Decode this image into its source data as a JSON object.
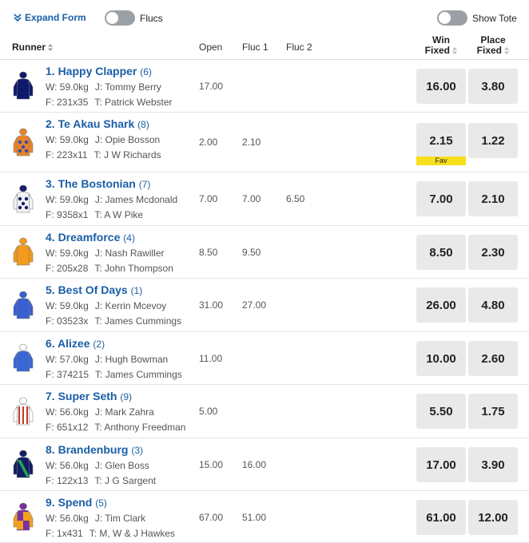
{
  "controls": {
    "expand_form": "Expand Form",
    "flucs_label": "Flucs",
    "show_tote_label": "Show Tote"
  },
  "header": {
    "runner": "Runner",
    "open": "Open",
    "fluc1": "Fluc 1",
    "fluc2": "Fluc 2",
    "win_line1": "Win",
    "win_line2": "Fixed",
    "place_line1": "Place",
    "place_line2": "Fixed"
  },
  "runners": [
    {
      "name": "1. Happy Clapper",
      "barrier": "(6)",
      "weight": "W: 59.0kg",
      "jockey": "J: Tommy Berry",
      "form": "F: 231x35",
      "trainer": "T: Patrick Webster",
      "open": "17.00",
      "fluc1": "",
      "fluc2": "",
      "win": "16.00",
      "place": "3.80",
      "fav": ""
    },
    {
      "name": "2. Te Akau Shark",
      "barrier": "(8)",
      "weight": "W: 59.0kg",
      "jockey": "J: Opie Bosson",
      "form": "F: 223x11",
      "trainer": "T: J W Richards",
      "open": "2.00",
      "fluc1": "2.10",
      "fluc2": "",
      "win": "2.15",
      "place": "1.22",
      "fav": "Fav"
    },
    {
      "name": "3. The Bostonian",
      "barrier": "(7)",
      "weight": "W: 59.0kg",
      "jockey": "J: James Mcdonald",
      "form": "F: 9358x1",
      "trainer": "T: A W Pike",
      "open": "7.00",
      "fluc1": "7.00",
      "fluc2": "6.50",
      "win": "7.00",
      "place": "2.10",
      "fav": ""
    },
    {
      "name": "4. Dreamforce",
      "barrier": "(4)",
      "weight": "W: 59.0kg",
      "jockey": "J: Nash Rawiller",
      "form": "F: 205x28",
      "trainer": "T: John Thompson",
      "open": "8.50",
      "fluc1": "9.50",
      "fluc2": "",
      "win": "8.50",
      "place": "2.30",
      "fav": ""
    },
    {
      "name": "5. Best Of Days",
      "barrier": "(1)",
      "weight": "W: 59.0kg",
      "jockey": "J: Kerrin Mcevoy",
      "form": "F: 03523x",
      "trainer": "T: James Cummings",
      "open": "31.00",
      "fluc1": "27.00",
      "fluc2": "",
      "win": "26.00",
      "place": "4.80",
      "fav": ""
    },
    {
      "name": "6. Alizee",
      "barrier": "(2)",
      "weight": "W: 57.0kg",
      "jockey": "J: Hugh Bowman",
      "form": "F: 374215",
      "trainer": "T: James Cummings",
      "open": "11.00",
      "fluc1": "",
      "fluc2": "",
      "win": "10.00",
      "place": "2.60",
      "fav": ""
    },
    {
      "name": "7. Super Seth",
      "barrier": "(9)",
      "weight": "W: 56.0kg",
      "jockey": "J: Mark Zahra",
      "form": "F: 651x12",
      "trainer": "T: Anthony Freedman",
      "open": "5.00",
      "fluc1": "",
      "fluc2": "",
      "win": "5.50",
      "place": "1.75",
      "fav": ""
    },
    {
      "name": "8. Brandenburg",
      "barrier": "(3)",
      "weight": "W: 56.0kg",
      "jockey": "J: Glen Boss",
      "form": "F: 122x13",
      "trainer": "T: J G Sargent",
      "open": "15.00",
      "fluc1": "16.00",
      "fluc2": "",
      "win": "17.00",
      "place": "3.90",
      "fav": ""
    },
    {
      "name": "9. Spend",
      "barrier": "(5)",
      "weight": "W: 56.0kg",
      "jockey": "J: Tim Clark",
      "form": "F: 1x431",
      "trainer": "T: M, W & J Hawkes",
      "open": "67.00",
      "fluc1": "51.00",
      "fluc2": "",
      "win": "61.00",
      "place": "12.00",
      "fav": ""
    }
  ],
  "silks": [
    {
      "icon": "silk-navy-icon",
      "body": "#0d1a6b",
      "sleeves": "#0d1a6b",
      "cap": "#0d1a6b"
    },
    {
      "icon": "silk-orange-blue-spots-icon",
      "body": "#e8832a",
      "sleeves": "#e8832a",
      "cap": "#e8832a",
      "spots": "#3a4aa8"
    },
    {
      "icon": "silk-white-navy-spots-icon",
      "body": "#f2f2f2",
      "sleeves": "#f2f2f2",
      "cap": "#1a1f6b",
      "spots": "#1a1f6b"
    },
    {
      "icon": "silk-orange-icon",
      "body": "#f29a1c",
      "sleeves": "#f29a1c",
      "cap": "#f29a1c"
    },
    {
      "icon": "silk-royal-blue-icon",
      "body": "#3a5fd0",
      "sleeves": "#3a5fd0",
      "cap": "#3a5fd0"
    },
    {
      "icon": "silk-royal-blue-white-cap-icon",
      "body": "#3a66d6",
      "sleeves": "#3a66d6",
      "cap": "#ffffff"
    },
    {
      "icon": "silk-white-red-stripes-icon",
      "body": "#ffffff",
      "sleeves": "#ffffff",
      "cap": "#ffffff",
      "stripes": "#c0392b"
    },
    {
      "icon": "silk-navy-green-sash-icon",
      "body": "#121d66",
      "sleeves": "#121d66",
      "cap": "#121d66",
      "sash": "#1fa84a"
    },
    {
      "icon": "silk-purple-orange-quarters-icon",
      "body": "#7b2ea0",
      "sleeves": "#f0a020",
      "cap": "#7b2ea0",
      "quarter": "#f0a020"
    }
  ]
}
